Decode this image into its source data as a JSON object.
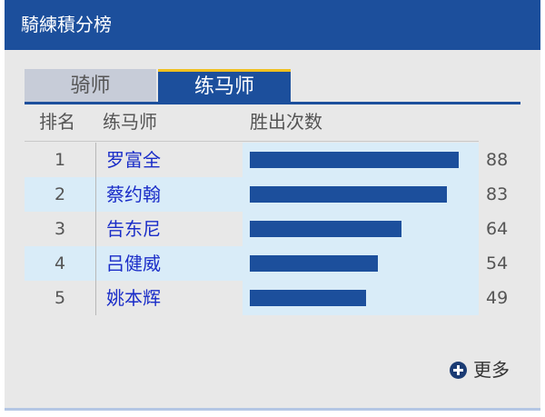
{
  "header": {
    "title": "騎練積分榜"
  },
  "tabs": [
    {
      "label": "骑师",
      "active": false
    },
    {
      "label": "练马师",
      "active": true
    }
  ],
  "table": {
    "columns": {
      "rank": "排名",
      "trainer": "练马师",
      "wins": "胜出次数"
    },
    "max_wins": 88,
    "rows": [
      {
        "rank": "1",
        "name": "罗富全",
        "wins": 88
      },
      {
        "rank": "2",
        "name": "蔡约翰",
        "wins": 83
      },
      {
        "rank": "3",
        "name": "告东尼",
        "wins": 64
      },
      {
        "rank": "4",
        "name": "吕健威",
        "wins": 54
      },
      {
        "rank": "5",
        "name": "姚本辉",
        "wins": 49
      }
    ]
  },
  "more": {
    "label": "更多",
    "icon": "plus-circle-icon"
  },
  "colors": {
    "header": "#1c4f9c",
    "bar": "#1c4f9c",
    "tab_accent": "#f0c020",
    "link": "#1a2dc8"
  }
}
